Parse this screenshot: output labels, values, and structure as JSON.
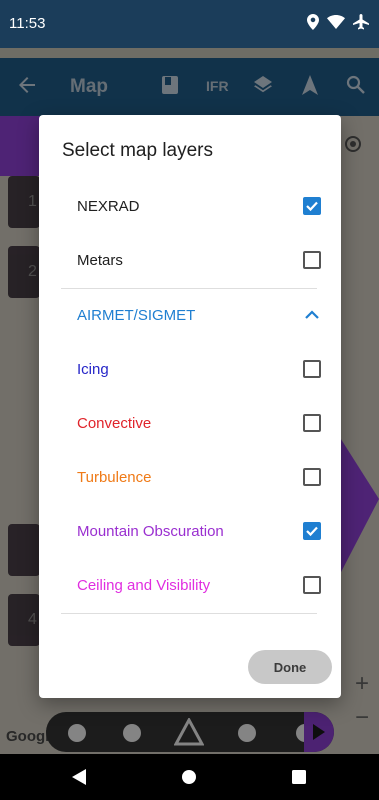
{
  "status_bar": {
    "time": "11:53"
  },
  "app_bar": {
    "title": "Map",
    "ifr_label": "IFR"
  },
  "map": {
    "tiles": [
      "1",
      "2",
      "",
      "4"
    ],
    "attribution": "Google",
    "zoom_in": "+",
    "zoom_out": "−"
  },
  "dialog": {
    "title": "Select map layers",
    "layers": [
      {
        "label": "NEXRAD",
        "checked": true,
        "color": "#202020"
      },
      {
        "label": "Metars",
        "checked": false,
        "color": "#202020"
      }
    ],
    "section": {
      "label": "AIRMET/SIGMET",
      "color": "#1f7fd1",
      "expanded": true
    },
    "sub_layers": [
      {
        "label": "Icing",
        "checked": false,
        "color": "#2626c8"
      },
      {
        "label": "Convective",
        "checked": false,
        "color": "#e0242b"
      },
      {
        "label": "Turbulence",
        "checked": false,
        "color": "#ef7a17"
      },
      {
        "label": "Mountain Obscuration",
        "checked": true,
        "color": "#9a2fd0"
      },
      {
        "label": "Ceiling and Visibility",
        "checked": false,
        "color": "#e02ee0"
      }
    ],
    "done_label": "Done"
  },
  "icons": [
    "location-icon",
    "wifi-icon",
    "airplane-mode-icon",
    "back-arrow-icon",
    "book-icon",
    "layers-icon",
    "navigation-arrow-icon",
    "search-icon",
    "my-location-icon",
    "play-icon",
    "nav-back-icon",
    "nav-home-icon",
    "nav-recents-icon"
  ]
}
